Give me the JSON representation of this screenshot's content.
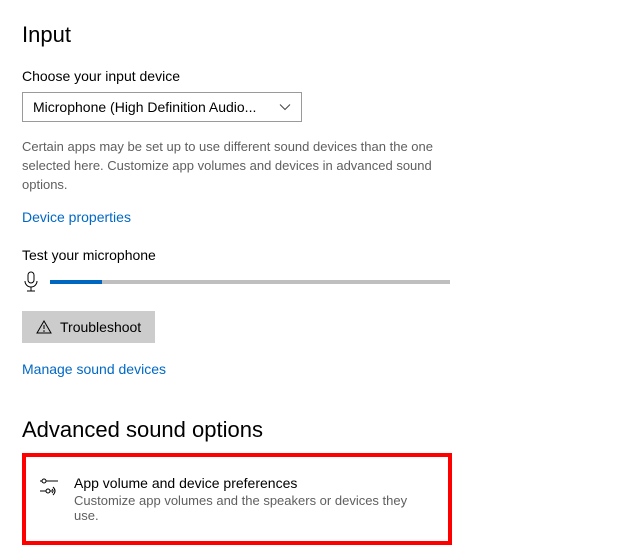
{
  "input": {
    "heading": "Input",
    "choose_label": "Choose your input device",
    "device_selected": "Microphone (High Definition Audio...",
    "description": "Certain apps may be set up to use different sound devices than the one selected here. Customize app volumes and devices in advanced sound options.",
    "device_properties_link": "Device properties",
    "test_label": "Test your microphone",
    "mic_level_percent": 13,
    "troubleshoot_label": "Troubleshoot",
    "manage_link": "Manage sound devices"
  },
  "advanced": {
    "heading": "Advanced sound options",
    "item": {
      "title": "App volume and device preferences",
      "subtitle": "Customize app volumes and the speakers or devices they use."
    }
  }
}
